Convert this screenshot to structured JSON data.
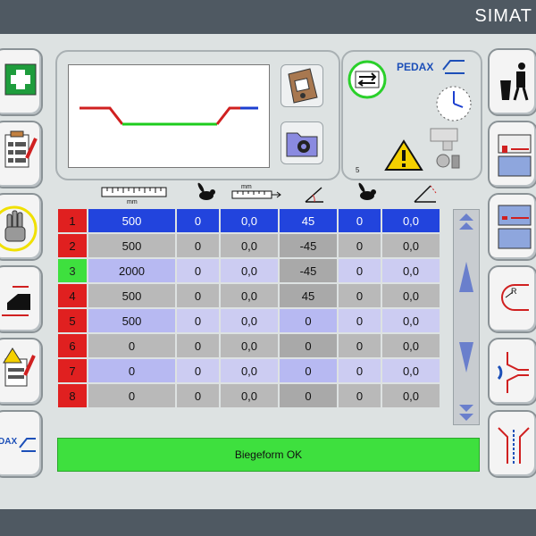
{
  "header": {
    "brand": "SIMAT"
  },
  "logo": {
    "text": "PEDAX"
  },
  "info_panel": {
    "page_number": "5"
  },
  "columns": [
    {
      "name": "length",
      "icon": "ruler-icon",
      "unit": "mm"
    },
    {
      "name": "speed",
      "icon": "rabbit-icon"
    },
    {
      "name": "backgauge",
      "icon": "measure-arrows-icon",
      "unit": "mm"
    },
    {
      "name": "angle",
      "icon": "angle-icon"
    },
    {
      "name": "speed2",
      "icon": "rabbit-icon"
    },
    {
      "name": "angle2",
      "icon": "angle-corner-icon"
    }
  ],
  "rows": [
    {
      "num": "1",
      "status": "error",
      "values": [
        "500",
        "0",
        "0,0",
        "45",
        "0",
        "0,0"
      ]
    },
    {
      "num": "2",
      "status": "error",
      "values": [
        "500",
        "0",
        "0,0",
        "-45",
        "0",
        "0,0"
      ]
    },
    {
      "num": "3",
      "status": "ok",
      "values": [
        "2000",
        "0",
        "0,0",
        "-45",
        "0",
        "0,0"
      ]
    },
    {
      "num": "4",
      "status": "error",
      "values": [
        "500",
        "0",
        "0,0",
        "45",
        "0",
        "0,0"
      ]
    },
    {
      "num": "5",
      "status": "error",
      "values": [
        "500",
        "0",
        "0,0",
        "0",
        "0",
        "0,0"
      ]
    },
    {
      "num": "6",
      "status": "error",
      "values": [
        "0",
        "0",
        "0,0",
        "0",
        "0",
        "0,0"
      ]
    },
    {
      "num": "7",
      "status": "error",
      "values": [
        "0",
        "0",
        "0,0",
        "0",
        "0",
        "0,0"
      ]
    },
    {
      "num": "8",
      "status": "error",
      "values": [
        "0",
        "0",
        "0,0",
        "0",
        "0",
        "0,0"
      ]
    }
  ],
  "status_bar": {
    "text": "Biegeform OK"
  },
  "colors": {
    "ok": "#3ee03e",
    "error": "#e02020",
    "selected": "#2244dd",
    "highlight": "#ffee00"
  }
}
